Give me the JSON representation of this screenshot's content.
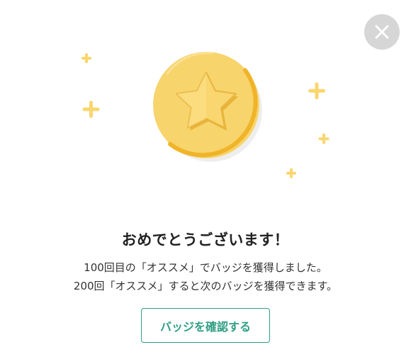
{
  "modal": {
    "title": "おめでとうございます！",
    "message_line1": "100回目の「オススメ」でバッジを獲得しました。",
    "message_line2": "200回「オススメ」すると次のバッジを獲得できます。",
    "confirm_button_label": "バッジを確認する",
    "close_icon": "close-icon",
    "badge_icon": "star-coin-icon",
    "sparkle_icon": "sparkle-icon"
  },
  "colors": {
    "coin": "#f7d46c",
    "coin_edge": "#f0b429",
    "star": "#f9d66f",
    "sparkle": "#f9d66f",
    "accent": "#2e9e84",
    "close_bg": "#d6d6d6"
  }
}
